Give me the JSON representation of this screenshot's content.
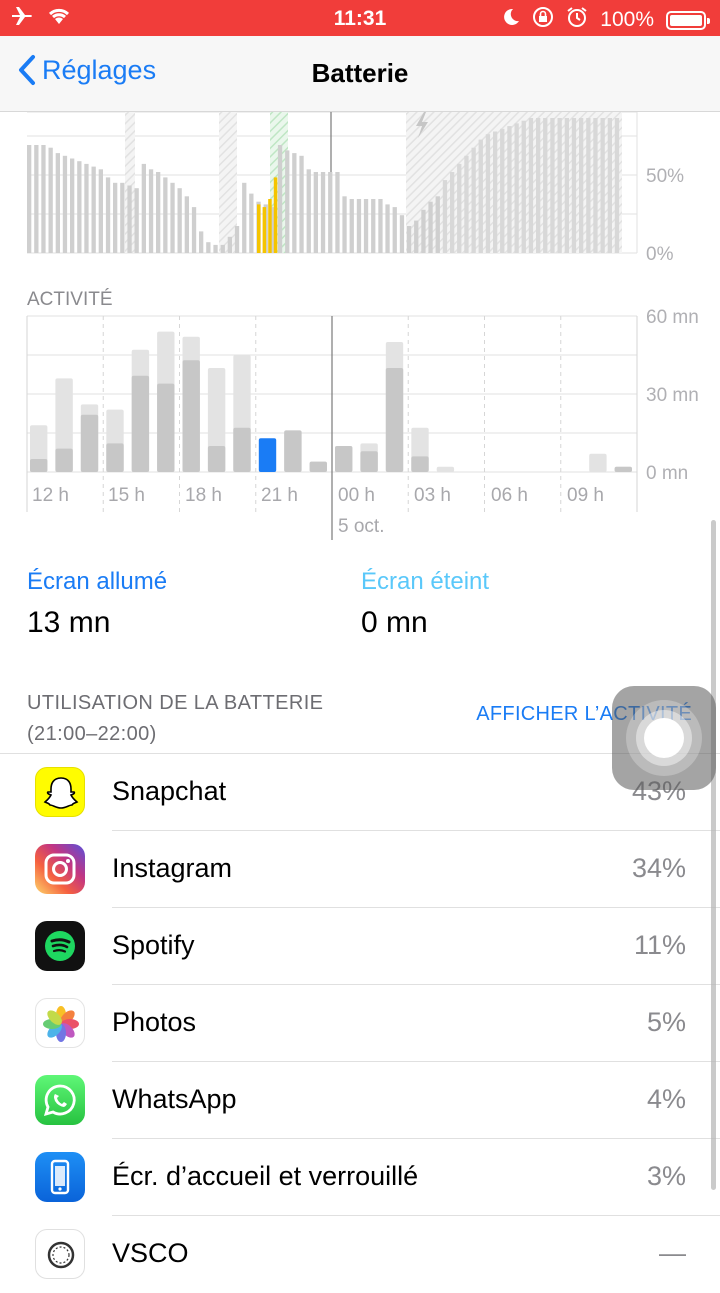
{
  "status": {
    "time": "11:31",
    "battery": "100%"
  },
  "nav": {
    "back_label": "Réglages",
    "title": "Batterie"
  },
  "chart_data": [
    {
      "type": "bar",
      "title": "",
      "y_ticks": [
        "50%",
        "0%"
      ],
      "ylim": [
        0,
        100
      ],
      "note": "battery level",
      "values": [
        80,
        80,
        80,
        78,
        74,
        72,
        70,
        68,
        66,
        64,
        62,
        56,
        52,
        52,
        50,
        48,
        66,
        62,
        60,
        56,
        52,
        48,
        42,
        34,
        16,
        8,
        6,
        6,
        12,
        20,
        52,
        44,
        38,
        36,
        34,
        80,
        76,
        74,
        72,
        62,
        60,
        60,
        60,
        60,
        42,
        40,
        40,
        40,
        40,
        40,
        36,
        34,
        28,
        20,
        24,
        32,
        38,
        42,
        54,
        60,
        66,
        72,
        78,
        84,
        88,
        90,
        92,
        94,
        96,
        98,
        100,
        100,
        100,
        100,
        100,
        100,
        100,
        100,
        100,
        100,
        100,
        100,
        100
      ],
      "highlight_values": [
        36,
        34,
        40,
        56
      ]
    },
    {
      "type": "bar",
      "title": "ACTIVITÉ",
      "categories": [
        "12 h",
        "15 h",
        "18 h",
        "21 h",
        "00 h",
        "03 h",
        "06 h",
        "09 h"
      ],
      "date_label": "5 oct.",
      "y_ticks": [
        "60 mn",
        "30 mn",
        "0 mn"
      ],
      "ylim": [
        0,
        60
      ],
      "series": [
        {
          "values": [
            5,
            9,
            22,
            11,
            37,
            34,
            43,
            10,
            17,
            13,
            16,
            4,
            10,
            8,
            40,
            6,
            0,
            0,
            0,
            0,
            0,
            0,
            0,
            2
          ]
        },
        {
          "values": [
            18,
            36,
            26,
            24,
            47,
            54,
            52,
            40,
            45,
            13,
            16,
            4,
            10,
            11,
            50,
            17,
            2,
            0,
            0,
            0,
            0,
            0,
            7,
            2
          ]
        }
      ],
      "highlight_index": 9
    }
  ],
  "chart_text": {
    "battery_y_ticks": [
      "50%",
      "0%"
    ],
    "activity_label": "ACTIVITÉ",
    "activity_y_ticks": [
      "60 mn",
      "30 mn",
      "0 mn"
    ],
    "x_ticks": [
      "12 h",
      "15 h",
      "18 h",
      "21 h",
      "00 h",
      "03 h",
      "06 h",
      "09 h"
    ],
    "date_label": "5 oct."
  },
  "screen": {
    "on_label": "Écran allumé",
    "on_value": "13 mn",
    "off_label": "Écran éteint",
    "off_value": "0 mn"
  },
  "usage": {
    "title_line1": "UTILISATION DE LA BATTERIE",
    "title_line2": "(21:00–22:00)",
    "link": "AFFICHER L’ACTIVITÉ"
  },
  "apps": [
    {
      "name": "Snapchat",
      "pct": "43%",
      "icon": "snapchat-icon"
    },
    {
      "name": "Instagram",
      "pct": "34%",
      "icon": "instagram-icon"
    },
    {
      "name": "Spotify",
      "pct": "11%",
      "icon": "spotify-icon"
    },
    {
      "name": "Photos",
      "pct": "5%",
      "icon": "photos-icon"
    },
    {
      "name": "WhatsApp",
      "pct": "4%",
      "icon": "whatsapp-icon"
    },
    {
      "name": "Écr. d’accueil et verrouillé",
      "pct": "3%",
      "icon": "home-lock-screen-icon"
    },
    {
      "name": "VSCO",
      "pct": "—",
      "icon": "vsco-icon"
    }
  ],
  "colors": {
    "accent": "#1a7cf5",
    "status_bar": "#f13d3a",
    "highlight_yellow": "#f5c400",
    "bar_gray": "#c7c7c7",
    "bar_light": "#e3e3e3"
  }
}
